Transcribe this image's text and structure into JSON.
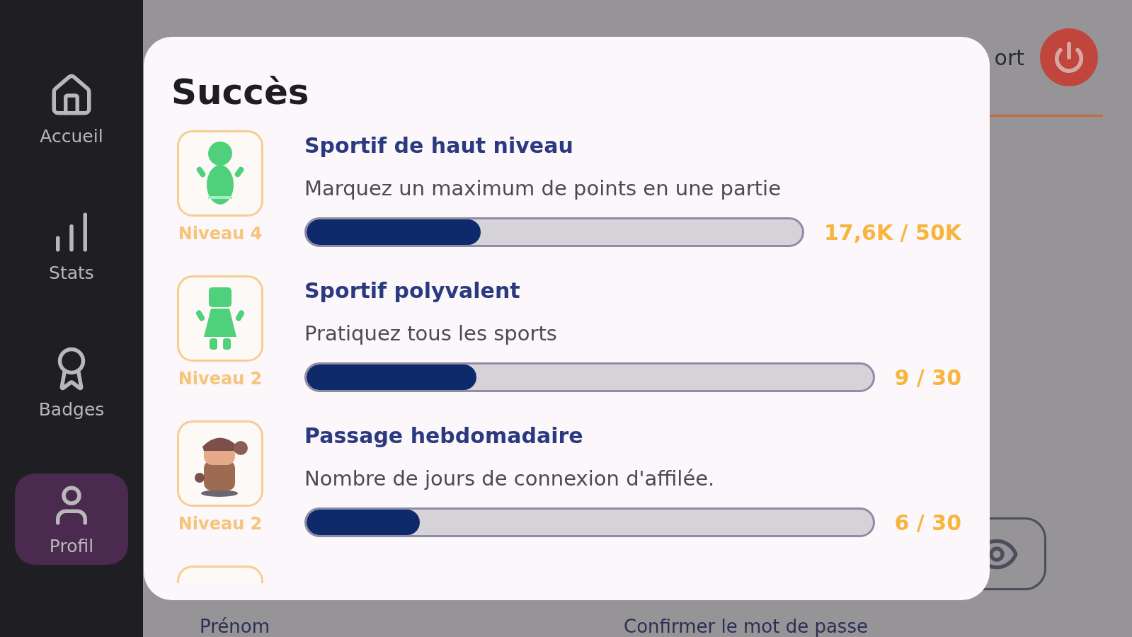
{
  "sidebar": {
    "items": [
      {
        "label": "Accueil",
        "selected": false
      },
      {
        "label": "Stats",
        "selected": false
      },
      {
        "label": "Badges",
        "selected": false
      },
      {
        "label": "Profil",
        "selected": true
      }
    ]
  },
  "header": {
    "text": "ort"
  },
  "form": {
    "labels": [
      "Prénom",
      "Confirmer le mot de passe"
    ]
  },
  "modal": {
    "title": "Succès",
    "achievements": [
      {
        "level_label": "Niveau 4",
        "title": "Sportif de haut niveau",
        "description": "Marquez un maximum de points en une partie",
        "level": 0.352,
        "reading": "17,6K / 50K"
      },
      {
        "level_label": "Niveau 2",
        "title": "Sportif polyvalent",
        "description": "Pratiquez tous les sports",
        "level": 0.3,
        "reading": "9 / 30"
      },
      {
        "level_label": "Niveau 2",
        "title": "Passage hebdomadaire",
        "description": "Nombre de jours de connexion d'affilée.",
        "level": 0.2,
        "reading": "6 / 30"
      }
    ]
  }
}
